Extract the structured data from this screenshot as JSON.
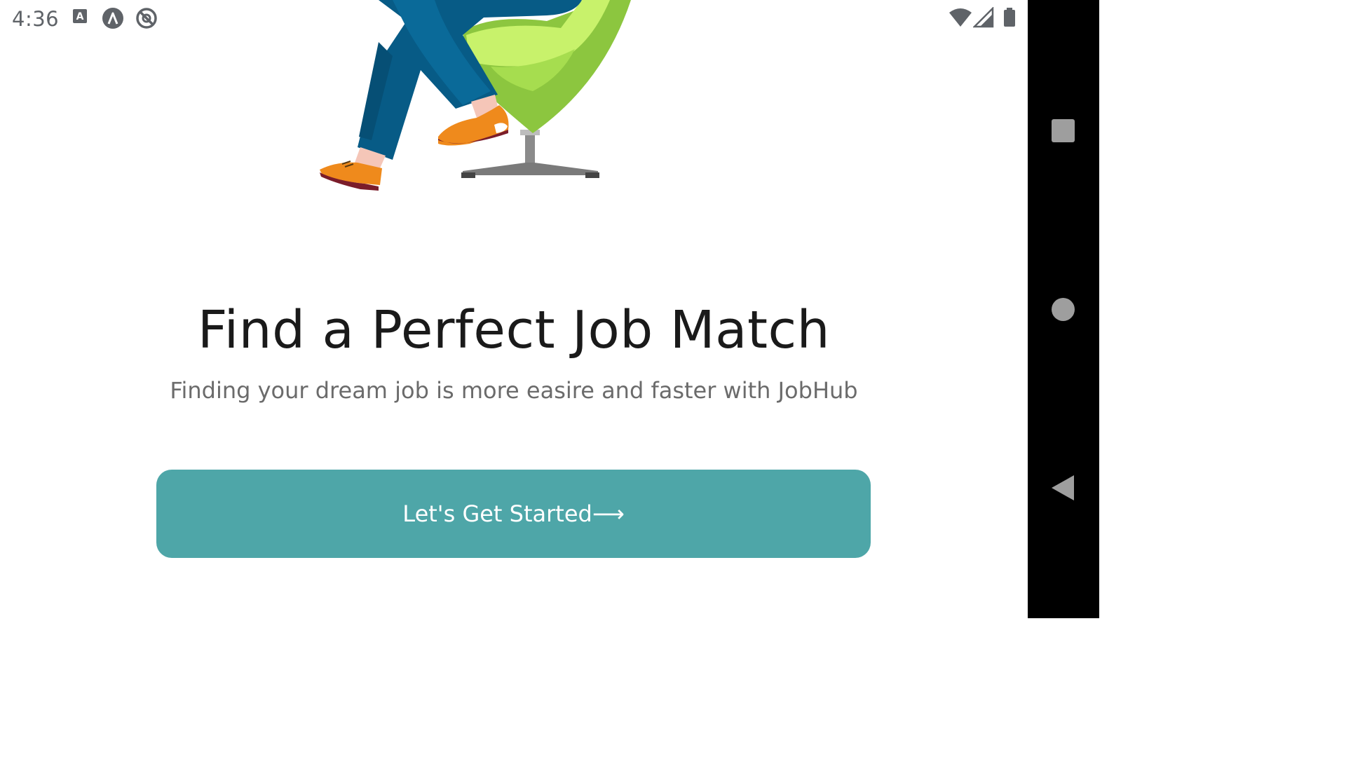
{
  "status_bar": {
    "time": "4:36",
    "left_icons": [
      "keyboard-a-icon",
      "app-lambda-icon",
      "no-sync-icon"
    ],
    "right_icons": [
      "wifi-icon",
      "signal-icon",
      "battery-icon"
    ]
  },
  "onboarding": {
    "title": "Find a Perfect Job Match",
    "subtitle": "Finding your dream job is more easire and faster with JobHub",
    "cta_label": "Let's Get Started",
    "cta_arrow": "⟶"
  },
  "navigation": {
    "buttons": [
      "recents-square-icon",
      "home-circle-icon",
      "back-triangle-icon"
    ]
  },
  "colors": {
    "accent": "#4ea6a8",
    "title": "#1a1a1a",
    "subtitle": "#6b6b6b",
    "navbar": "#000000"
  }
}
